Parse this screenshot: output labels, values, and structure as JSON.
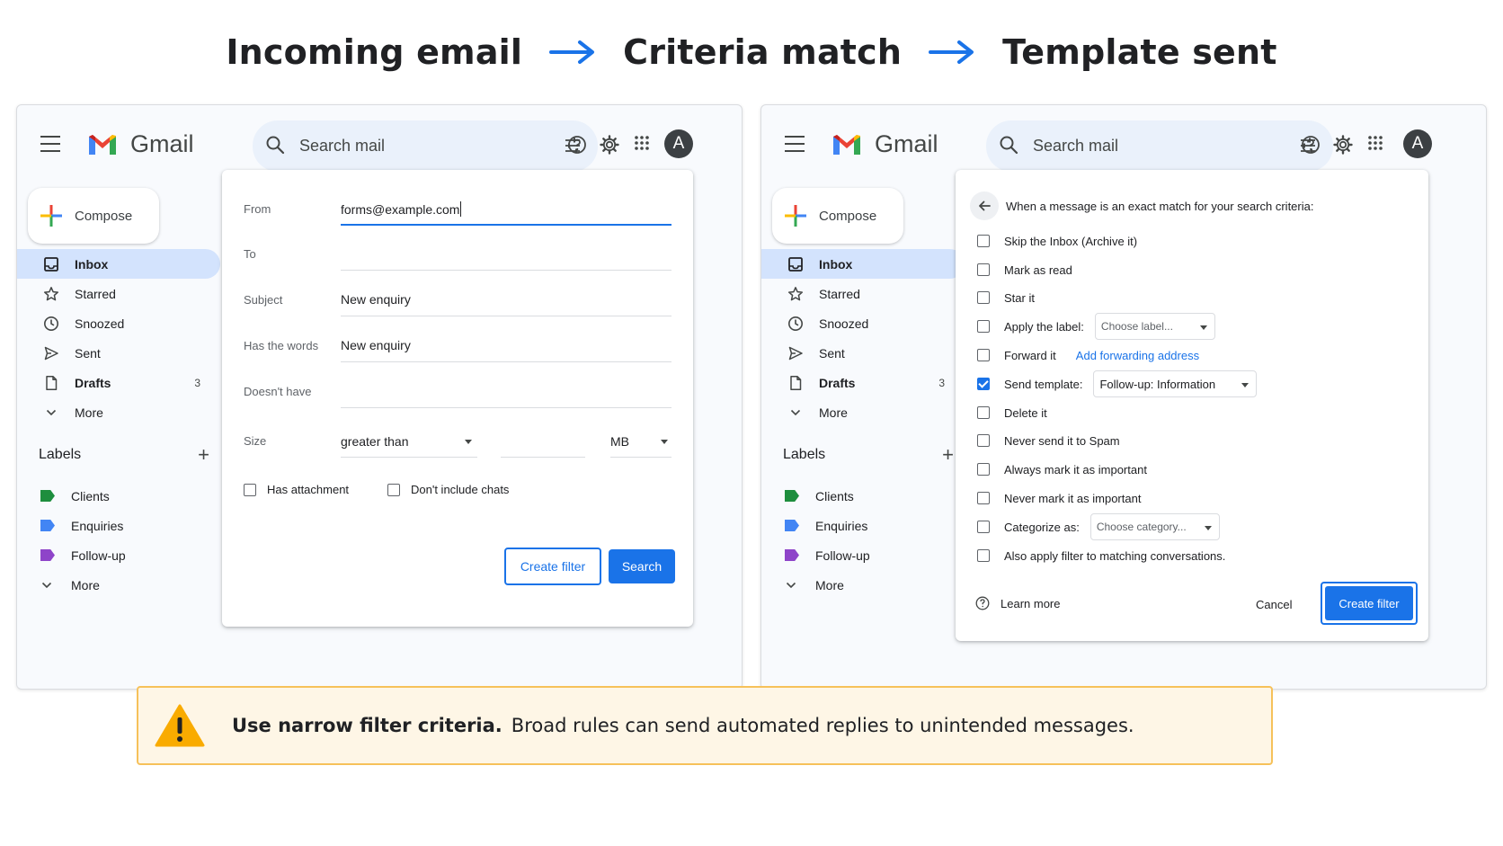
{
  "flow": {
    "step1": "Incoming email",
    "step2": "Criteria match",
    "step3": "Template sent",
    "arrow_color": "#1a73e8"
  },
  "gmail": {
    "brand": "Gmail",
    "search_placeholder": "Search mail",
    "avatar_initial": "A",
    "compose_label": "Compose",
    "nav": [
      {
        "label": "Inbox",
        "icon": "inbox-icon",
        "active": true
      },
      {
        "label": "Starred",
        "icon": "star-icon"
      },
      {
        "label": "Snoozed",
        "icon": "clock-icon"
      },
      {
        "label": "Sent",
        "icon": "send-icon"
      },
      {
        "label": "Drafts",
        "icon": "draft-icon",
        "count": "3"
      },
      {
        "label": "More",
        "icon": "chevron-down-icon"
      }
    ],
    "labels_heading": "Labels",
    "labels": [
      {
        "name": "Clients",
        "color": "#1e8e3e"
      },
      {
        "name": "Enquiries",
        "color": "#4285f4"
      },
      {
        "name": "Follow-up",
        "color": "#8e44c9"
      }
    ],
    "labels_more": "More"
  },
  "filter_form": {
    "from_label": "From",
    "from_value": "forms@example.com",
    "to_label": "To",
    "to_value": "",
    "subject_label": "Subject",
    "subject_value": "New enquiry",
    "has_words_label": "Has the words",
    "has_words_value": "New enquiry",
    "doesnt_have_label": "Doesn't have",
    "doesnt_have_value": "",
    "size_label": "Size",
    "size_operator": "greater than",
    "size_unit": "MB",
    "has_attachment_label": "Has attachment",
    "exclude_chats_label": "Don't include chats",
    "create_filter_label": "Create filter",
    "search_label": "Search"
  },
  "filter_actions": {
    "heading": "When a message is an exact match for your search criteria:",
    "skip_inbox": "Skip the Inbox (Archive it)",
    "mark_read": "Mark as read",
    "star_it": "Star it",
    "apply_label": "Apply the label:",
    "apply_label_select": "Choose label...",
    "forward_it": "Forward it",
    "forward_link": "Add forwarding address",
    "send_template": "Send template:",
    "send_template_select": "Follow-up: Information",
    "send_template_checked": true,
    "delete_it": "Delete it",
    "never_spam": "Never send it to Spam",
    "always_important": "Always mark it as important",
    "never_important": "Never mark it as important",
    "categorize": "Categorize as:",
    "categorize_select": "Choose category...",
    "also_apply": "Also apply filter to matching conversations.",
    "learn_more": "Learn more",
    "cancel": "Cancel",
    "create_filter": "Create filter"
  },
  "warning": {
    "strong": "Use narrow filter criteria.",
    "text": "Broad rules can send automated replies to unintended messages."
  }
}
